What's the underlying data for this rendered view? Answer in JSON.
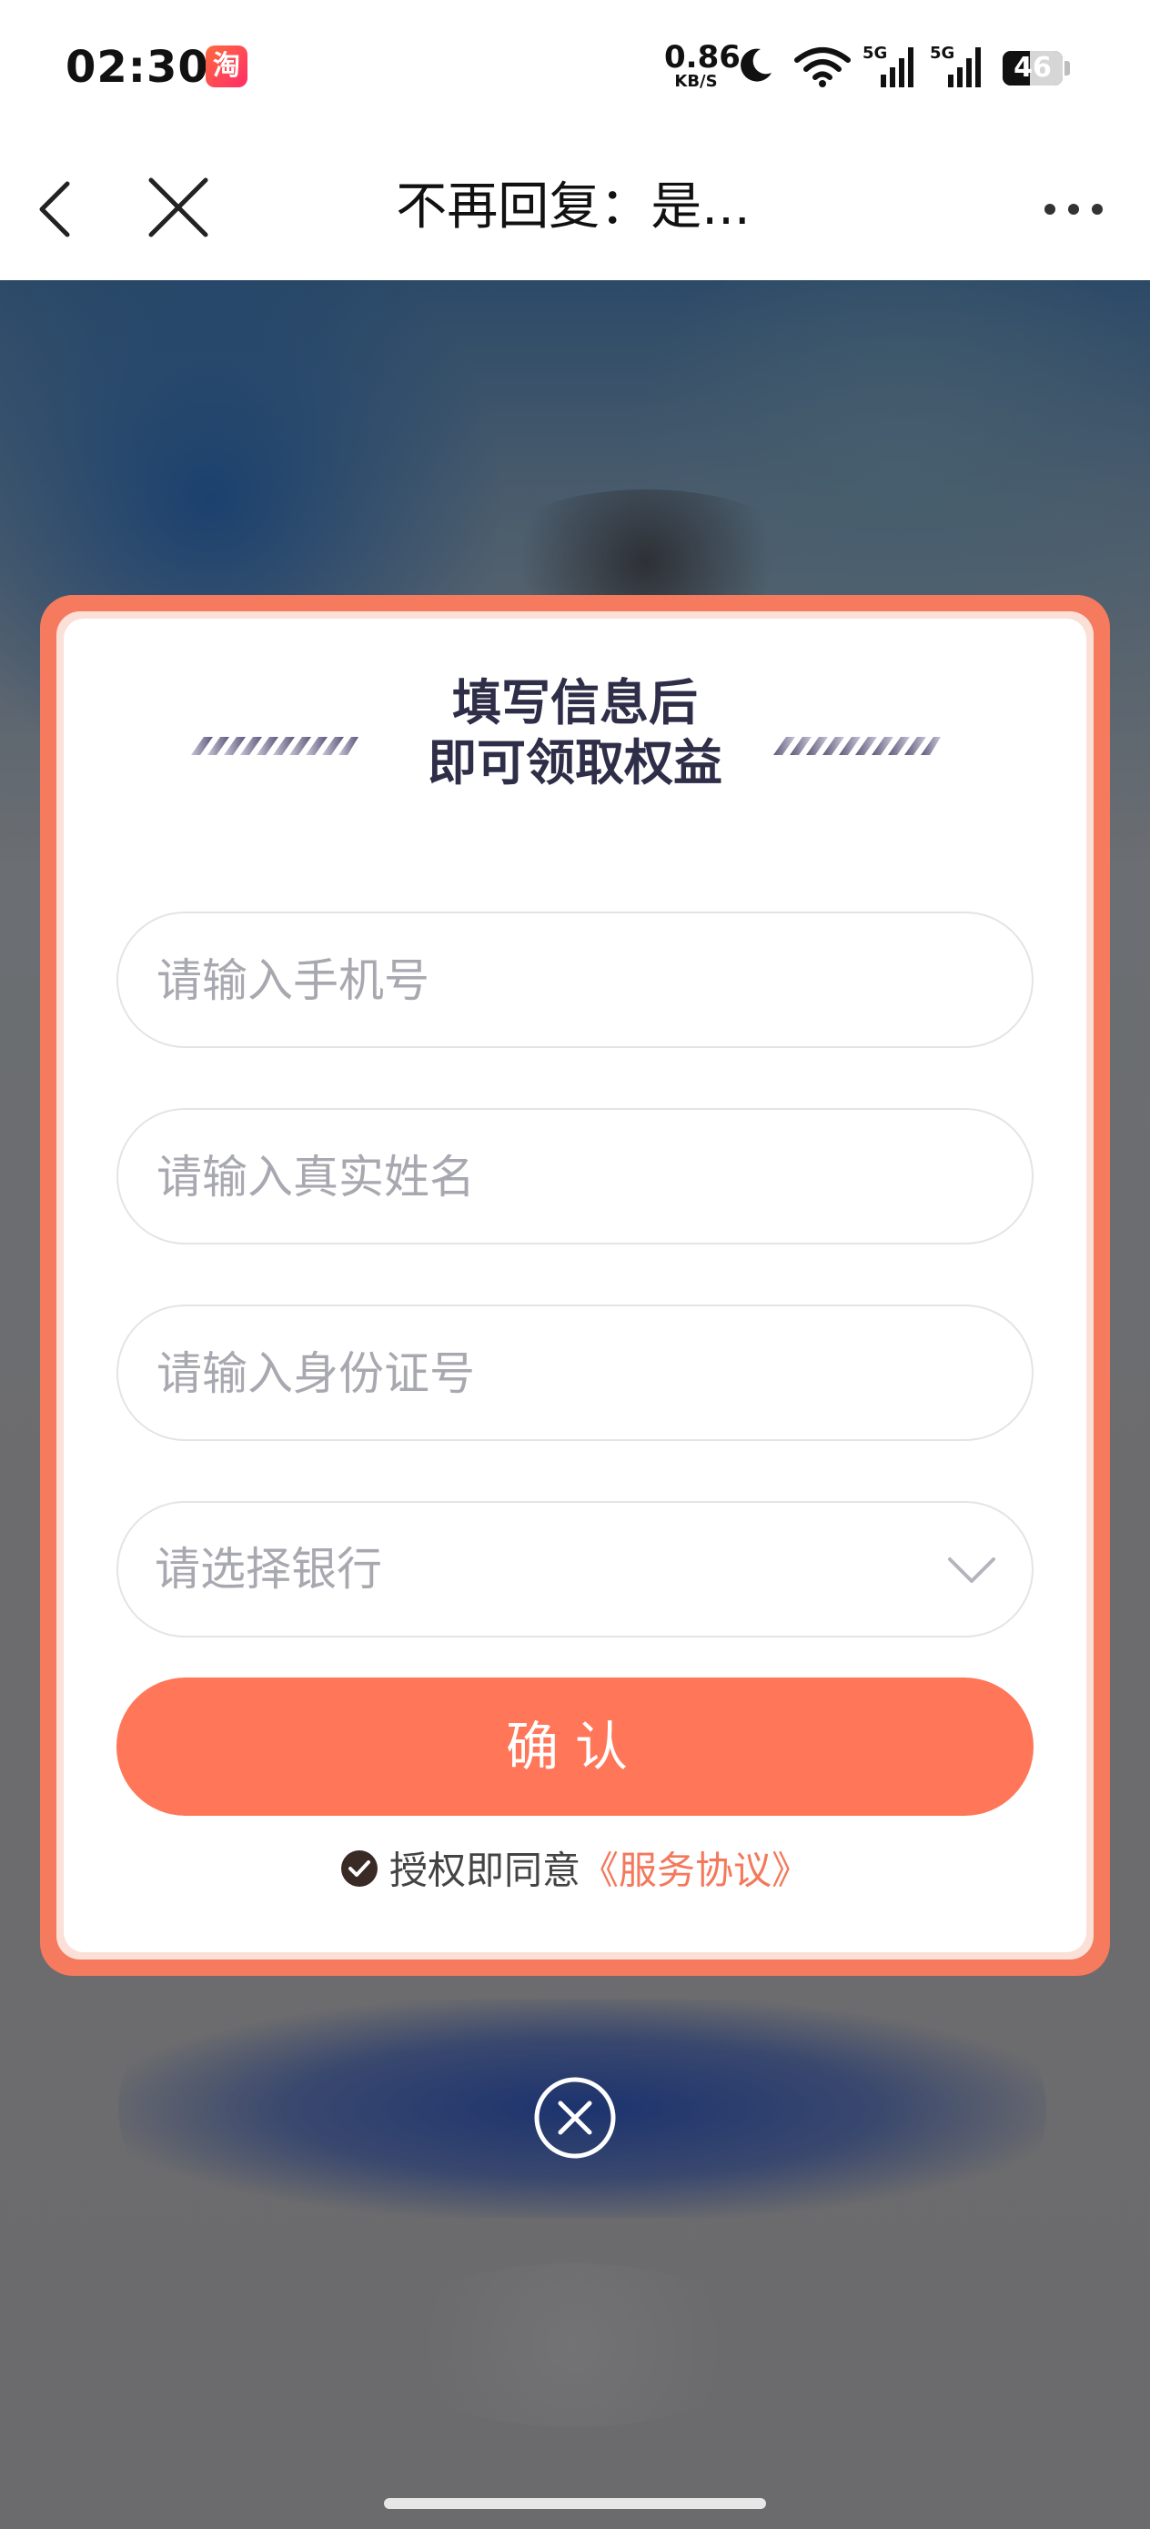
{
  "status_bar": {
    "time": "02:30",
    "app_icon_glyph": "淘",
    "net_speed_value": "0.86",
    "net_speed_unit": "KB/S",
    "signal_1_label": "5G",
    "signal_2_label": "5G",
    "battery_level": "46"
  },
  "nav": {
    "title": "不再回复：是..."
  },
  "modal": {
    "title_line1": "填写信息后",
    "title_line2": "即可领取权益",
    "phone_placeholder": "请输入手机号",
    "name_placeholder": "请输入真实姓名",
    "id_placeholder": "请输入身份证号",
    "bank_select_value": "请选择银行",
    "confirm_label": "确认",
    "agree_text": "授权即同意",
    "agreement_link": "《服务协议》"
  },
  "colors": {
    "accent": "#ff7659",
    "frame": "#f57a5e",
    "title_text": "#2e2e48",
    "link": "#f4795c"
  },
  "icons": [
    "taobao-app-icon",
    "moon-icon",
    "wifi-icon",
    "signal-icon",
    "battery-icon",
    "back-arrow-icon",
    "close-icon",
    "more-icon",
    "chevron-down-icon",
    "check-circle-icon",
    "close-circle-icon"
  ]
}
